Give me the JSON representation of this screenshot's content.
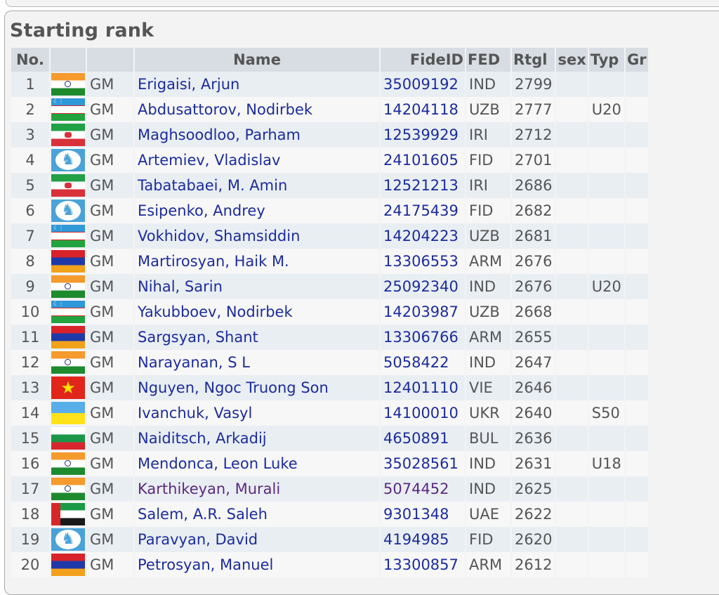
{
  "page_title": "Starting rank",
  "headers": {
    "no": "No.",
    "title": "",
    "name": "Name",
    "fide_id": "FideID",
    "fed": "FED",
    "rating": "Rtgl",
    "sex": "sex",
    "type": "Typ",
    "group": "Gr"
  },
  "colors": {
    "link": "#1c2c9c",
    "visited_link": "#5a2a80",
    "header_bg": "#d8dde3",
    "row_odd_bg": "#e9eef3",
    "row_even_bg": "#f7f7f7"
  },
  "players": [
    {
      "no": "1",
      "flag": "india-flag-icon",
      "title": "GM",
      "name": "Erigaisi, Arjun",
      "fide_id": "35009192",
      "fed": "IND",
      "rating": "2799",
      "sex": "",
      "type": "",
      "group": ""
    },
    {
      "no": "2",
      "flag": "uzbekistan-flag-icon",
      "title": "GM",
      "name": "Abdusattorov, Nodirbek",
      "fide_id": "14204118",
      "fed": "UZB",
      "rating": "2777",
      "sex": "",
      "type": "U20",
      "group": ""
    },
    {
      "no": "3",
      "flag": "iran-flag-icon",
      "title": "GM",
      "name": "Maghsoodloo, Parham",
      "fide_id": "12539929",
      "fed": "IRI",
      "rating": "2712",
      "sex": "",
      "type": "",
      "group": ""
    },
    {
      "no": "4",
      "flag": "fide-flag-icon",
      "title": "GM",
      "name": "Artemiev, Vladislav",
      "fide_id": "24101605",
      "fed": "FID",
      "rating": "2701",
      "sex": "",
      "type": "",
      "group": ""
    },
    {
      "no": "5",
      "flag": "iran-flag-icon",
      "title": "GM",
      "name": "Tabatabaei, M. Amin",
      "fide_id": "12521213",
      "fed": "IRI",
      "rating": "2686",
      "sex": "",
      "type": "",
      "group": ""
    },
    {
      "no": "6",
      "flag": "fide-flag-icon",
      "title": "GM",
      "name": "Esipenko, Andrey",
      "fide_id": "24175439",
      "fed": "FID",
      "rating": "2682",
      "sex": "",
      "type": "",
      "group": ""
    },
    {
      "no": "7",
      "flag": "uzbekistan-flag-icon",
      "title": "GM",
      "name": "Vokhidov, Shamsiddin",
      "fide_id": "14204223",
      "fed": "UZB",
      "rating": "2681",
      "sex": "",
      "type": "",
      "group": ""
    },
    {
      "no": "8",
      "flag": "armenia-flag-icon",
      "title": "GM",
      "name": "Martirosyan, Haik M.",
      "fide_id": "13306553",
      "fed": "ARM",
      "rating": "2676",
      "sex": "",
      "type": "",
      "group": ""
    },
    {
      "no": "9",
      "flag": "india-flag-icon",
      "title": "GM",
      "name": "Nihal, Sarin",
      "fide_id": "25092340",
      "fed": "IND",
      "rating": "2676",
      "sex": "",
      "type": "U20",
      "group": ""
    },
    {
      "no": "10",
      "flag": "uzbekistan-flag-icon",
      "title": "GM",
      "name": "Yakubboev, Nodirbek",
      "fide_id": "14203987",
      "fed": "UZB",
      "rating": "2668",
      "sex": "",
      "type": "",
      "group": ""
    },
    {
      "no": "11",
      "flag": "armenia-flag-icon",
      "title": "GM",
      "name": "Sargsyan, Shant",
      "fide_id": "13306766",
      "fed": "ARM",
      "rating": "2655",
      "sex": "",
      "type": "",
      "group": ""
    },
    {
      "no": "12",
      "flag": "india-flag-icon",
      "title": "GM",
      "name": "Narayanan, S L",
      "fide_id": "5058422",
      "fed": "IND",
      "rating": "2647",
      "sex": "",
      "type": "",
      "group": ""
    },
    {
      "no": "13",
      "flag": "vietnam-flag-icon",
      "title": "GM",
      "name": "Nguyen, Ngoc Truong Son",
      "fide_id": "12401110",
      "fed": "VIE",
      "rating": "2646",
      "sex": "",
      "type": "",
      "group": ""
    },
    {
      "no": "14",
      "flag": "ukraine-flag-icon",
      "title": "GM",
      "name": "Ivanchuk, Vasyl",
      "fide_id": "14100010",
      "fed": "UKR",
      "rating": "2640",
      "sex": "",
      "type": "S50",
      "group": ""
    },
    {
      "no": "15",
      "flag": "bulgaria-flag-icon",
      "title": "GM",
      "name": "Naiditsch, Arkadij",
      "fide_id": "4650891",
      "fed": "BUL",
      "rating": "2636",
      "sex": "",
      "type": "",
      "group": ""
    },
    {
      "no": "16",
      "flag": "india-flag-icon",
      "title": "GM",
      "name": "Mendonca, Leon Luke",
      "fide_id": "35028561",
      "fed": "IND",
      "rating": "2631",
      "sex": "",
      "type": "U18",
      "group": ""
    },
    {
      "no": "17",
      "flag": "india-flag-icon",
      "title": "GM",
      "name": "Karthikeyan, Murali",
      "fide_id": "5074452",
      "fed": "IND",
      "rating": "2625",
      "sex": "",
      "type": "",
      "group": "",
      "visited": true
    },
    {
      "no": "18",
      "flag": "uae-flag-icon",
      "title": "GM",
      "name": "Salem, A.R. Saleh",
      "fide_id": "9301348",
      "fed": "UAE",
      "rating": "2622",
      "sex": "",
      "type": "",
      "group": ""
    },
    {
      "no": "19",
      "flag": "fide-flag-icon",
      "title": "GM",
      "name": "Paravyan, David",
      "fide_id": "4194985",
      "fed": "FID",
      "rating": "2620",
      "sex": "",
      "type": "",
      "group": ""
    },
    {
      "no": "20",
      "flag": "armenia-flag-icon",
      "title": "GM",
      "name": "Petrosyan, Manuel",
      "fide_id": "13300857",
      "fed": "ARM",
      "rating": "2612",
      "sex": "",
      "type": "",
      "group": ""
    }
  ]
}
